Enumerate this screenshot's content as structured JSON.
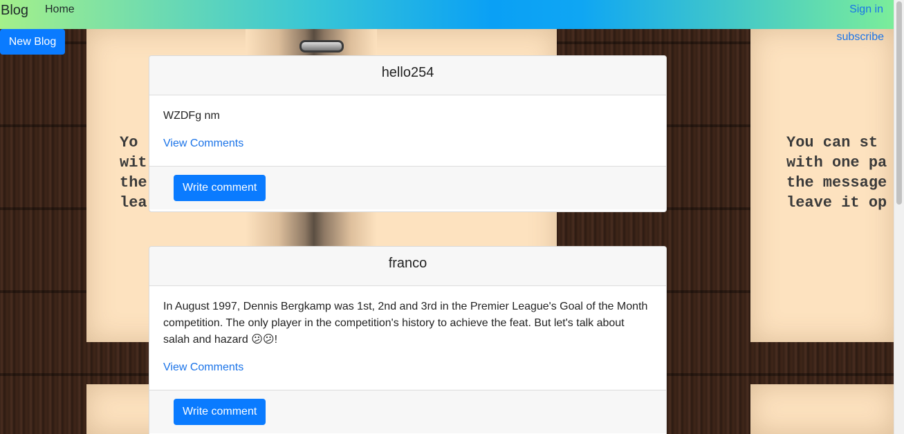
{
  "navbar": {
    "brand": "Blog",
    "home": "Home",
    "sign_in": "Sign in"
  },
  "actions": {
    "new_blog": "New Blog",
    "subscribe": "subscribe"
  },
  "background": {
    "left_text": "Yo\nwit\nthe\nlea",
    "right_text": "You can st\nwith one pa\nthe message\nleave it op"
  },
  "posts": [
    {
      "title": "hello254",
      "body": "WZDFg nm",
      "view_comments": "View Comments",
      "write_comment": "Write comment"
    },
    {
      "title": "franco",
      "body": "In August 1997, Dennis Bergkamp was 1st, 2nd and 3rd in the Premier League's Goal of the Month competition. The only player in the competition's history to achieve the feat. But let's talk about salah and hazard 😕😕!",
      "view_comments": "View Comments",
      "write_comment": "Write comment"
    }
  ]
}
